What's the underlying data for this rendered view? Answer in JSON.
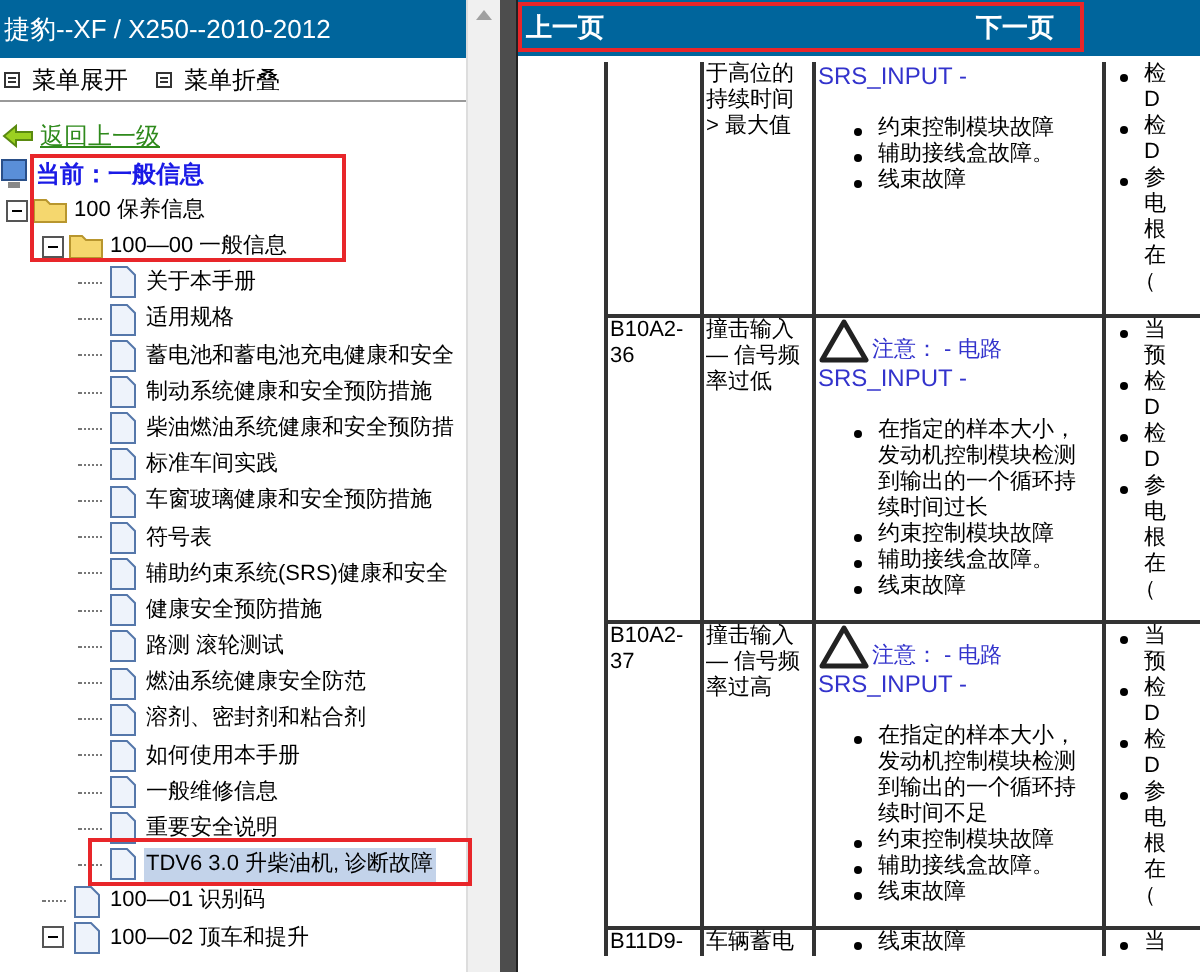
{
  "sidebar": {
    "title": "捷豹--XF / X250--2010-2012",
    "menu": [
      "菜单展开",
      "菜单折叠"
    ],
    "back_link": "返回上一级",
    "current": "当前：一般信息",
    "tree": [
      {
        "label": "100 保养信息",
        "expanded": true,
        "selected": false,
        "children": [
          {
            "label": "100—00 一般信息",
            "expanded": true,
            "selected": false,
            "children": [
              {
                "label": "关于本手册",
                "selected": false
              },
              {
                "label": "适用规格",
                "selected": false
              },
              {
                "label": "蓄电池和蓄电池充电健康和安全",
                "selected": false
              },
              {
                "label": "制动系统健康和安全预防措施",
                "selected": false
              },
              {
                "label": "柴油燃油系统健康和安全预防措",
                "selected": false
              },
              {
                "label": "标准车间实践",
                "selected": false
              },
              {
                "label": "车窗玻璃健康和安全预防措施",
                "selected": false
              },
              {
                "label": "符号表",
                "selected": false
              },
              {
                "label": "辅助约束系统(SRS)健康和安全",
                "selected": false
              },
              {
                "label": "健康安全预防措施",
                "selected": false
              },
              {
                "label": "路测 滚轮测试",
                "selected": false
              },
              {
                "label": "燃油系统健康安全防范",
                "selected": false
              },
              {
                "label": "溶剂、密封剂和粘合剂",
                "selected": false
              },
              {
                "label": "如何使用本手册",
                "selected": false
              },
              {
                "label": "一般维修信息",
                "selected": false
              },
              {
                "label": "重要安全说明",
                "selected": false
              },
              {
                "label": "TDV6 3.0 升柴油机, 诊断故障",
                "selected": true
              }
            ]
          },
          {
            "label": "100—01 识别码",
            "selected": false
          },
          {
            "label": "100—02 顶车和提升",
            "expanded": true,
            "selected": false
          }
        ]
      }
    ]
  },
  "content": {
    "prev": "上一页",
    "next": "下一页",
    "rows": [
      {
        "code": "",
        "description": "于高位的持续时间 > 最大值",
        "caution": "",
        "signal": "SRS_INPUT -",
        "causes": [
          "约束控制模块故障",
          "辅助接线盒故障。",
          "线束故障"
        ],
        "actions": [
          {
            "kind": "bullet",
            "text": "检D"
          },
          {
            "kind": "bullet",
            "text": "检D"
          },
          {
            "kind": "bullet",
            "text": "参电根在"
          },
          {
            "kind": "plain",
            "text": "（"
          }
        ]
      },
      {
        "code": "B10A2-36",
        "description": "撞击输入 — 信号频率过低",
        "caution": "注意： - 电路",
        "signal": "SRS_INPUT -",
        "causes": [
          "在指定的样本大小，发动机控制模块检测到输出的一个循环持续时间过长",
          "约束控制模块故障",
          "辅助接线盒故障。",
          "线束故障"
        ],
        "actions": [
          {
            "kind": "bullet",
            "text": "当预"
          },
          {
            "kind": "bullet",
            "text": "检D"
          },
          {
            "kind": "bullet",
            "text": "检D"
          },
          {
            "kind": "bullet",
            "text": "参电根在"
          },
          {
            "kind": "plain",
            "text": "（"
          }
        ]
      },
      {
        "code": "B10A2-37",
        "description": "撞击输入 — 信号频率过高",
        "caution": "注意： - 电路",
        "signal": "SRS_INPUT -",
        "causes": [
          "在指定的样本大小，发动机控制模块检测到输出的一个循环持续时间不足",
          "约束控制模块故障",
          "辅助接线盒故障。",
          "线束故障"
        ],
        "actions": [
          {
            "kind": "bullet",
            "text": "当预"
          },
          {
            "kind": "bullet",
            "text": "检D"
          },
          {
            "kind": "bullet",
            "text": "检D"
          },
          {
            "kind": "bullet",
            "text": "参电根在"
          },
          {
            "kind": "plain",
            "text": "（"
          }
        ]
      },
      {
        "code": "B11D9-",
        "description": "车辆蓄电",
        "caution": "",
        "signal": "",
        "causes": [
          "线束故障"
        ],
        "actions": [
          {
            "kind": "bullet",
            "text": "当"
          }
        ]
      }
    ]
  }
}
